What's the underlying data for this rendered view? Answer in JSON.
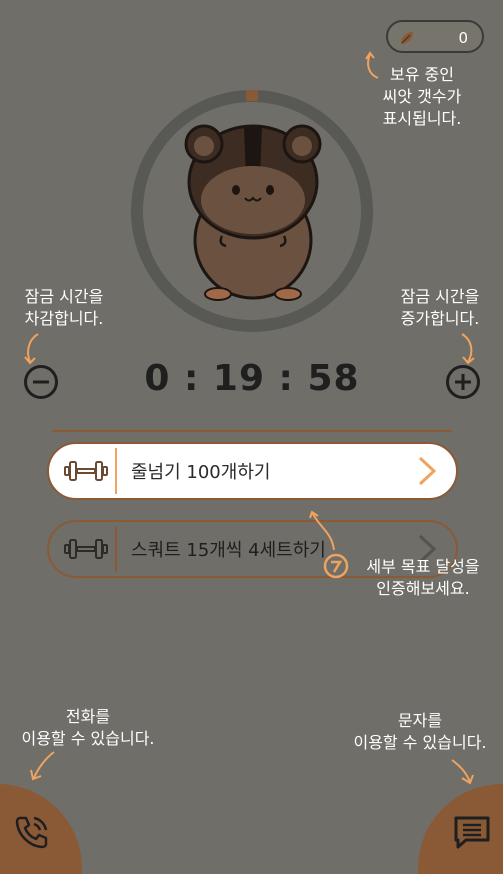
{
  "seeds": {
    "count": "0",
    "icon": "seed-icon"
  },
  "hints": {
    "seed_line1": "보유 중인",
    "seed_line2": "씨앗 갯수가",
    "seed_line3": "표시됩니다.",
    "decrease_line1": "잠금 시간을",
    "decrease_line2": "차감합니다.",
    "increase_line1": "잠금 시간을",
    "increase_line2": "증가합니다.",
    "goal_line1": "세부 목표 달성을",
    "goal_line2": "인증해보세요.",
    "phone_line1": "전화를",
    "phone_line2": "이용할 수 있습니다.",
    "message_line1": "문자를",
    "message_line2": "이용할 수 있습니다."
  },
  "timer": {
    "display": "0 : 19 : 58"
  },
  "tasks": [
    {
      "label": "줄넘기 100개하기",
      "icon": "dumbbell-icon",
      "state": "active"
    },
    {
      "label": "스쿼트 15개씩 4세트하기",
      "icon": "dumbbell-icon",
      "state": "inactive"
    }
  ],
  "colors": {
    "background": "#6f6e69",
    "accent_brown": "#8a5a36",
    "highlight_orange": "#f0a35e",
    "ring": "#585855"
  }
}
